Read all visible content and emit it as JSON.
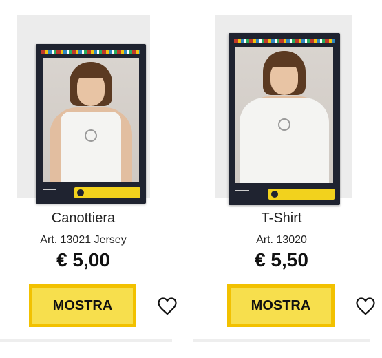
{
  "products": [
    {
      "title": "Canottiera",
      "article": "Art. 13021 Jersey",
      "price": "€ 5,00",
      "button_label": "MOSTRA",
      "image_alt": "Canottiera 13021"
    },
    {
      "title": "T-Shirt",
      "article": "Art. 13020",
      "price": "€ 5,50",
      "button_label": "MOSTRA",
      "image_alt": "T-Shirt 13020"
    }
  ],
  "colors": {
    "button_fill": "#f7df4d",
    "button_border": "#f2c100",
    "text": "#222222"
  },
  "icons": {
    "wishlist": "heart-outline-icon"
  }
}
